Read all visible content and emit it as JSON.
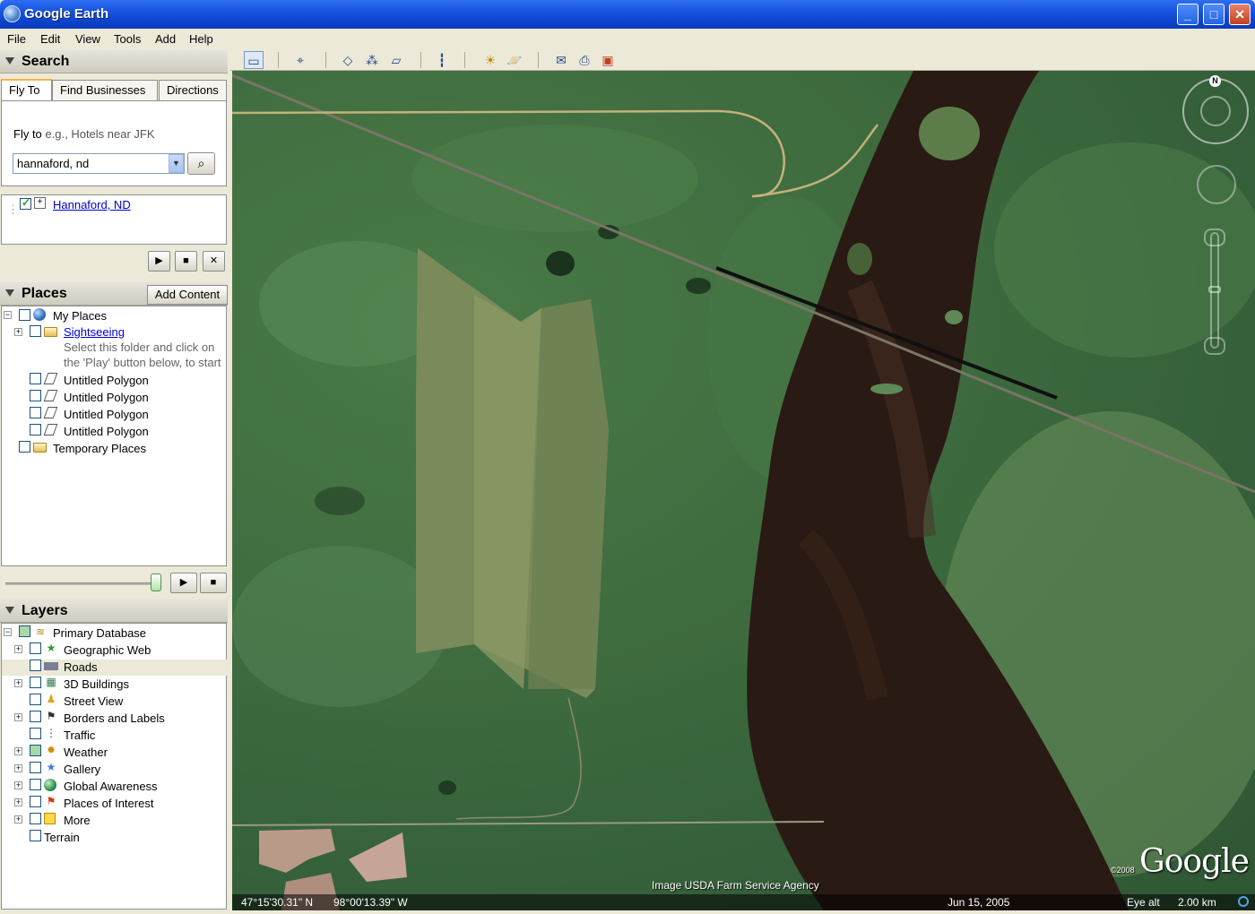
{
  "window": {
    "title": "Google Earth"
  },
  "menu": [
    "File",
    "Edit",
    "View",
    "Tools",
    "Add",
    "Help"
  ],
  "search": {
    "header": "Search",
    "tabs": [
      "Fly To",
      "Find Businesses",
      "Directions"
    ],
    "flyto_label": "Fly to",
    "flyto_hint": "e.g., Hotels near JFK",
    "query": "hannaford, nd",
    "result": "Hannaford, ND"
  },
  "places": {
    "header": "Places",
    "add_content": "Add Content",
    "my_places": "My Places",
    "sightseeing": "Sightseeing",
    "sightseeing_hint_1": "Select this folder and click on",
    "sightseeing_hint_2": "the 'Play' button below, to start",
    "polygons": [
      "Untitled Polygon",
      "Untitled Polygon",
      "Untitled Polygon",
      "Untitled Polygon"
    ],
    "temporary": "Temporary Places"
  },
  "layers": {
    "header": "Layers",
    "primary": "Primary Database",
    "items": [
      "Geographic Web",
      "Roads",
      "3D Buildings",
      "Street View",
      "Borders and Labels",
      "Traffic",
      "Weather",
      "Gallery",
      "Global Awareness",
      "Places of Interest",
      "More"
    ],
    "terrain": "Terrain"
  },
  "map": {
    "imagery_credit": "Image USDA Farm Service Agency",
    "logo": "Google",
    "copyright": "©2008",
    "north": "N",
    "lat": "47°15'30.31\" N",
    "lon": "98°00'13.39\" W",
    "date": "Jun 15, 2005",
    "eye_alt_label": "Eye alt",
    "eye_alt": "2.00 km"
  }
}
